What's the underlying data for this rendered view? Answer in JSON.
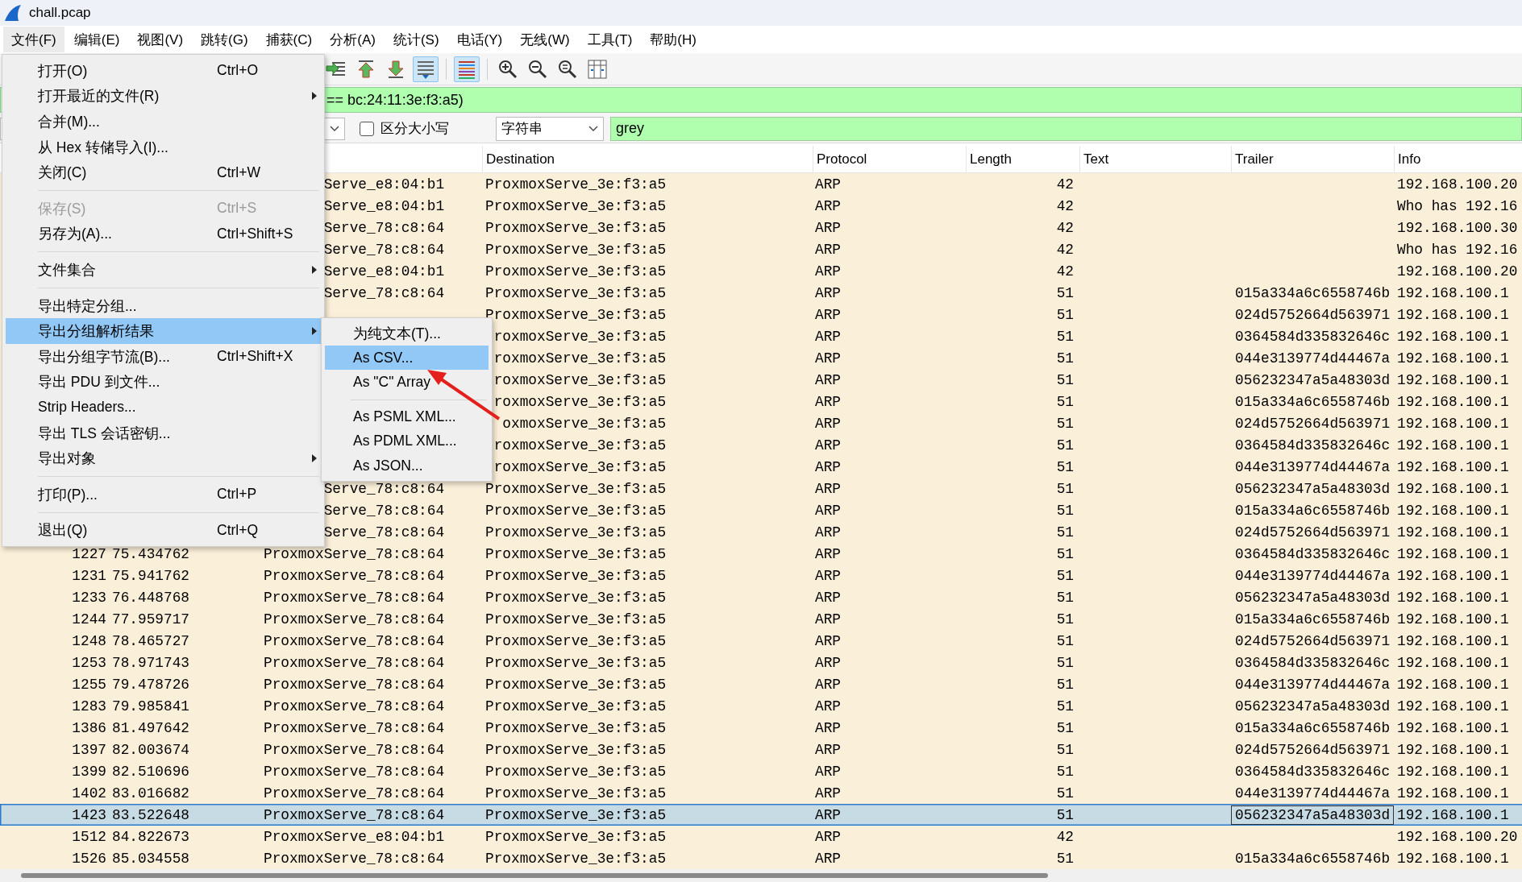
{
  "window": {
    "title": "chall.pcap"
  },
  "menu_bar": [
    {
      "label": "文件(F)",
      "selected": true
    },
    {
      "label": "编辑(E)",
      "selected": false
    },
    {
      "label": "视图(V)",
      "selected": false
    },
    {
      "label": "跳转(G)",
      "selected": false
    },
    {
      "label": "捕获(C)",
      "selected": false
    },
    {
      "label": "分析(A)",
      "selected": false
    },
    {
      "label": "统计(S)",
      "selected": false
    },
    {
      "label": "电话(Y)",
      "selected": false
    },
    {
      "label": "无线(W)",
      "selected": false
    },
    {
      "label": "工具(T)",
      "selected": false
    },
    {
      "label": "帮助(H)",
      "selected": false
    }
  ],
  "toolbar": [
    {
      "kind": "jump",
      "on": false
    },
    {
      "kind": "first",
      "on": false
    },
    {
      "kind": "last",
      "on": false
    },
    {
      "kind": "autoscroll",
      "on": true
    },
    {
      "kind": "colorize",
      "on": true
    },
    {
      "kind": "zoom-in",
      "on": false
    },
    {
      "kind": "zoom-out",
      "on": false
    },
    {
      "kind": "zoom-reset",
      "on": false
    },
    {
      "kind": "resize-columns",
      "on": false
    }
  ],
  "display_filter": {
    "value": "== bc:24:11:3e:f3:a5)"
  },
  "find_bar": {
    "case_sensitive": {
      "label": "区分大小写",
      "checked": false
    },
    "search_type": "字符串",
    "search_value": "grey"
  },
  "packet_list": {
    "columns": [
      "Destination",
      "Protocol",
      "Length",
      "Text",
      "Trailer",
      "Info"
    ],
    "rows": [
      {
        "source": "Serve_e8:04:b1",
        "destination": "ProxmoxServe_3e:f3:a5",
        "protocol": "ARP",
        "length": "42",
        "info": "192.168.100.20",
        "selected": false
      },
      {
        "source": "Serve_e8:04:b1",
        "destination": "ProxmoxServe_3e:f3:a5",
        "protocol": "ARP",
        "length": "42",
        "info": "Who has 192.16",
        "selected": false
      },
      {
        "source": "Serve_78:c8:64",
        "destination": "ProxmoxServe_3e:f3:a5",
        "protocol": "ARP",
        "length": "42",
        "info": "192.168.100.30",
        "selected": false
      },
      {
        "source": "Serve_78:c8:64",
        "destination": "ProxmoxServe_3e:f3:a5",
        "protocol": "ARP",
        "length": "42",
        "info": "Who has 192.16",
        "selected": false
      },
      {
        "source": "Serve_e8:04:b1",
        "destination": "ProxmoxServe_3e:f3:a5",
        "protocol": "ARP",
        "length": "42",
        "info": "192.168.100.20",
        "selected": false
      },
      {
        "source": "Serve_78:c8:64",
        "destination": "ProxmoxServe_3e:f3:a5",
        "protocol": "ARP",
        "length": "51",
        "trailer": "015a334a6c6558746b",
        "info": "192.168.100.1",
        "selected": false
      },
      {
        "destination": "ProxmoxServe_3e:f3:a5",
        "protocol": "ARP",
        "length": "51",
        "trailer": "024d5752664d563971",
        "info": "192.168.100.1",
        "selected": false
      },
      {
        "destination": "roxmoxServe_3e:f3:a5",
        "protocol": "ARP",
        "length": "51",
        "trailer": "0364584d335832646c",
        "info": "192.168.100.1",
        "selected": false
      },
      {
        "destination": "roxmoxServe_3e:f3:a5",
        "protocol": "ARP",
        "length": "51",
        "trailer": "044e3139774d44467a",
        "info": "192.168.100.1",
        "selected": false
      },
      {
        "destination": "roxmoxServe_3e:f3:a5",
        "protocol": "ARP",
        "length": "51",
        "trailer": "056232347a5a48303d",
        "info": "192.168.100.1",
        "selected": false
      },
      {
        "destination": "roxmoxServe_3e:f3:a5",
        "protocol": "ARP",
        "length": "51",
        "trailer": "015a334a6c6558746b",
        "info": "192.168.100.1",
        "selected": false
      },
      {
        "destination": "oxmoxServe_3e:f3:a5",
        "protocol": "ARP",
        "length": "51",
        "trailer": "024d5752664d563971",
        "info": "192.168.100.1",
        "selected": false
      },
      {
        "destination": "roxmoxServe_3e:f3:a5",
        "protocol": "ARP",
        "length": "51",
        "trailer": "0364584d335832646c",
        "info": "192.168.100.1",
        "selected": false
      },
      {
        "destination": "roxmoxServe_3e:f3:a5",
        "protocol": "ARP",
        "length": "51",
        "trailer": "044e3139774d44467a",
        "info": "192.168.100.1",
        "selected": false
      },
      {
        "source": "Serve_78:c8:64",
        "destination": "ProxmoxServe_3e:f3:a5",
        "protocol": "ARP",
        "length": "51",
        "trailer": "056232347a5a48303d",
        "info": "192.168.100.1",
        "selected": false
      },
      {
        "source": "Serve_78:c8:64",
        "destination": "ProxmoxServe_3e:f3:a5",
        "protocol": "ARP",
        "length": "51",
        "trailer": "015a334a6c6558746b",
        "info": "192.168.100.1",
        "selected": false
      },
      {
        "source": "Serve_78:c8:64",
        "destination": "ProxmoxServe_3e:f3:a5",
        "protocol": "ARP",
        "length": "51",
        "trailer": "024d5752664d563971",
        "info": "192.168.100.1",
        "selected": false
      },
      {
        "no": "1227",
        "time": "75.434762",
        "source": "ProxmoxServe_78:c8:64",
        "destination": "ProxmoxServe_3e:f3:a5",
        "protocol": "ARP",
        "length": "51",
        "trailer": "0364584d335832646c",
        "info": "192.168.100.1",
        "selected": false
      },
      {
        "no": "1231",
        "time": "75.941762",
        "source": "ProxmoxServe_78:c8:64",
        "destination": "ProxmoxServe_3e:f3:a5",
        "protocol": "ARP",
        "length": "51",
        "trailer": "044e3139774d44467a",
        "info": "192.168.100.1",
        "selected": false
      },
      {
        "no": "1233",
        "time": "76.448768",
        "source": "ProxmoxServe_78:c8:64",
        "destination": "ProxmoxServe_3e:f3:a5",
        "protocol": "ARP",
        "length": "51",
        "trailer": "056232347a5a48303d",
        "info": "192.168.100.1",
        "selected": false
      },
      {
        "no": "1244",
        "time": "77.959717",
        "source": "ProxmoxServe_78:c8:64",
        "destination": "ProxmoxServe_3e:f3:a5",
        "protocol": "ARP",
        "length": "51",
        "trailer": "015a334a6c6558746b",
        "info": "192.168.100.1",
        "selected": false
      },
      {
        "no": "1248",
        "time": "78.465727",
        "source": "ProxmoxServe_78:c8:64",
        "destination": "ProxmoxServe_3e:f3:a5",
        "protocol": "ARP",
        "length": "51",
        "trailer": "024d5752664d563971",
        "info": "192.168.100.1",
        "selected": false
      },
      {
        "no": "1253",
        "time": "78.971743",
        "source": "ProxmoxServe_78:c8:64",
        "destination": "ProxmoxServe_3e:f3:a5",
        "protocol": "ARP",
        "length": "51",
        "trailer": "0364584d335832646c",
        "info": "192.168.100.1",
        "selected": false
      },
      {
        "no": "1255",
        "time": "79.478726",
        "source": "ProxmoxServe_78:c8:64",
        "destination": "ProxmoxServe_3e:f3:a5",
        "protocol": "ARP",
        "length": "51",
        "trailer": "044e3139774d44467a",
        "info": "192.168.100.1",
        "selected": false
      },
      {
        "no": "1283",
        "time": "79.985841",
        "source": "ProxmoxServe_78:c8:64",
        "destination": "ProxmoxServe_3e:f3:a5",
        "protocol": "ARP",
        "length": "51",
        "trailer": "056232347a5a48303d",
        "info": "192.168.100.1",
        "selected": false
      },
      {
        "no": "1386",
        "time": "81.497642",
        "source": "ProxmoxServe_78:c8:64",
        "destination": "ProxmoxServe_3e:f3:a5",
        "protocol": "ARP",
        "length": "51",
        "trailer": "015a334a6c6558746b",
        "info": "192.168.100.1",
        "selected": false
      },
      {
        "no": "1397",
        "time": "82.003674",
        "source": "ProxmoxServe_78:c8:64",
        "destination": "ProxmoxServe_3e:f3:a5",
        "protocol": "ARP",
        "length": "51",
        "trailer": "024d5752664d563971",
        "info": "192.168.100.1",
        "selected": false
      },
      {
        "no": "1399",
        "time": "82.510696",
        "source": "ProxmoxServe_78:c8:64",
        "destination": "ProxmoxServe_3e:f3:a5",
        "protocol": "ARP",
        "length": "51",
        "trailer": "0364584d335832646c",
        "info": "192.168.100.1",
        "selected": false
      },
      {
        "no": "1402",
        "time": "83.016682",
        "source": "ProxmoxServe_78:c8:64",
        "destination": "ProxmoxServe_3e:f3:a5",
        "protocol": "ARP",
        "length": "51",
        "trailer": "044e3139774d44467a",
        "info": "192.168.100.1",
        "selected": false
      },
      {
        "no": "1423",
        "time": "83.522648",
        "source": "ProxmoxServe_78:c8:64",
        "destination": "ProxmoxServe_3e:f3:a5",
        "protocol": "ARP",
        "length": "51",
        "trailer": "056232347a5a48303d",
        "info": "192.168.100.1",
        "selected": true
      },
      {
        "no": "1512",
        "time": "84.822673",
        "source": "ProxmoxServe_e8:04:b1",
        "destination": "ProxmoxServe_3e:f3:a5",
        "protocol": "ARP",
        "length": "42",
        "info": "192.168.100.20",
        "selected": false
      },
      {
        "no": "1526",
        "time": "85.034558",
        "source": "ProxmoxServe_78:c8:64",
        "destination": "ProxmoxServe_3e:f3:a5",
        "protocol": "ARP",
        "length": "51",
        "trailer": "015a334a6c6558746b",
        "info": "192.168.100.1",
        "selected": false
      }
    ]
  },
  "file_menu": {
    "items": [
      {
        "kind": "item",
        "label": "打开(O)",
        "shortcut": "Ctrl+O",
        "submenu": false,
        "disabled": false,
        "selected": false
      },
      {
        "kind": "item",
        "label": "打开最近的文件(R)",
        "submenu": true,
        "disabled": false,
        "selected": false
      },
      {
        "kind": "item",
        "label": "合并(M)...",
        "submenu": false,
        "disabled": false,
        "selected": false
      },
      {
        "kind": "item",
        "label": "从 Hex 转储导入(I)...",
        "submenu": false,
        "disabled": false,
        "selected": false
      },
      {
        "kind": "item",
        "label": "关闭(C)",
        "shortcut": "Ctrl+W",
        "submenu": false,
        "disabled": false,
        "selected": false
      },
      {
        "kind": "separator"
      },
      {
        "kind": "item",
        "label": "保存(S)",
        "shortcut": "Ctrl+S",
        "submenu": false,
        "disabled": true,
        "selected": false
      },
      {
        "kind": "item",
        "label": "另存为(A)...",
        "shortcut": "Ctrl+Shift+S",
        "submenu": false,
        "disabled": false,
        "selected": false
      },
      {
        "kind": "separator"
      },
      {
        "kind": "item",
        "label": "文件集合",
        "submenu": true,
        "disabled": false,
        "selected": false
      },
      {
        "kind": "separator"
      },
      {
        "kind": "item",
        "label": "导出特定分组...",
        "submenu": false,
        "disabled": false,
        "selected": false
      },
      {
        "kind": "item",
        "label": "导出分组解析结果",
        "submenu": true,
        "disabled": false,
        "selected": true
      },
      {
        "kind": "item",
        "label": "导出分组字节流(B)...",
        "shortcut": "Ctrl+Shift+X",
        "submenu": false,
        "disabled": false,
        "selected": false
      },
      {
        "kind": "item",
        "label": "导出 PDU 到文件...",
        "submenu": false,
        "disabled": false,
        "selected": false
      },
      {
        "kind": "item",
        "label": "Strip Headers...",
        "submenu": false,
        "disabled": false,
        "selected": false
      },
      {
        "kind": "item",
        "label": "导出 TLS 会话密钥...",
        "submenu": false,
        "disabled": false,
        "selected": false
      },
      {
        "kind": "item",
        "label": "导出对象",
        "submenu": true,
        "disabled": false,
        "selected": false
      },
      {
        "kind": "separator"
      },
      {
        "kind": "item",
        "label": "打印(P)...",
        "shortcut": "Ctrl+P",
        "submenu": false,
        "disabled": false,
        "selected": false
      },
      {
        "kind": "separator"
      },
      {
        "kind": "item",
        "label": "退出(Q)",
        "shortcut": "Ctrl+Q",
        "submenu": false,
        "disabled": false,
        "selected": false
      }
    ]
  },
  "export_submenu": {
    "items": [
      {
        "kind": "item",
        "label": "为纯文本(T)...",
        "submenu": false,
        "disabled": false,
        "selected": false
      },
      {
        "kind": "item",
        "label": "As CSV...",
        "submenu": false,
        "disabled": false,
        "selected": true
      },
      {
        "kind": "item",
        "label": "As \"C\" Array",
        "submenu": false,
        "disabled": false,
        "selected": false
      },
      {
        "kind": "separator"
      },
      {
        "kind": "item",
        "label": "As PSML XML...",
        "submenu": false,
        "disabled": false,
        "selected": false
      },
      {
        "kind": "item",
        "label": "As PDML XML...",
        "submenu": false,
        "disabled": false,
        "selected": false
      },
      {
        "kind": "item",
        "label": "As JSON...",
        "submenu": false,
        "disabled": false,
        "selected": false
      }
    ]
  }
}
